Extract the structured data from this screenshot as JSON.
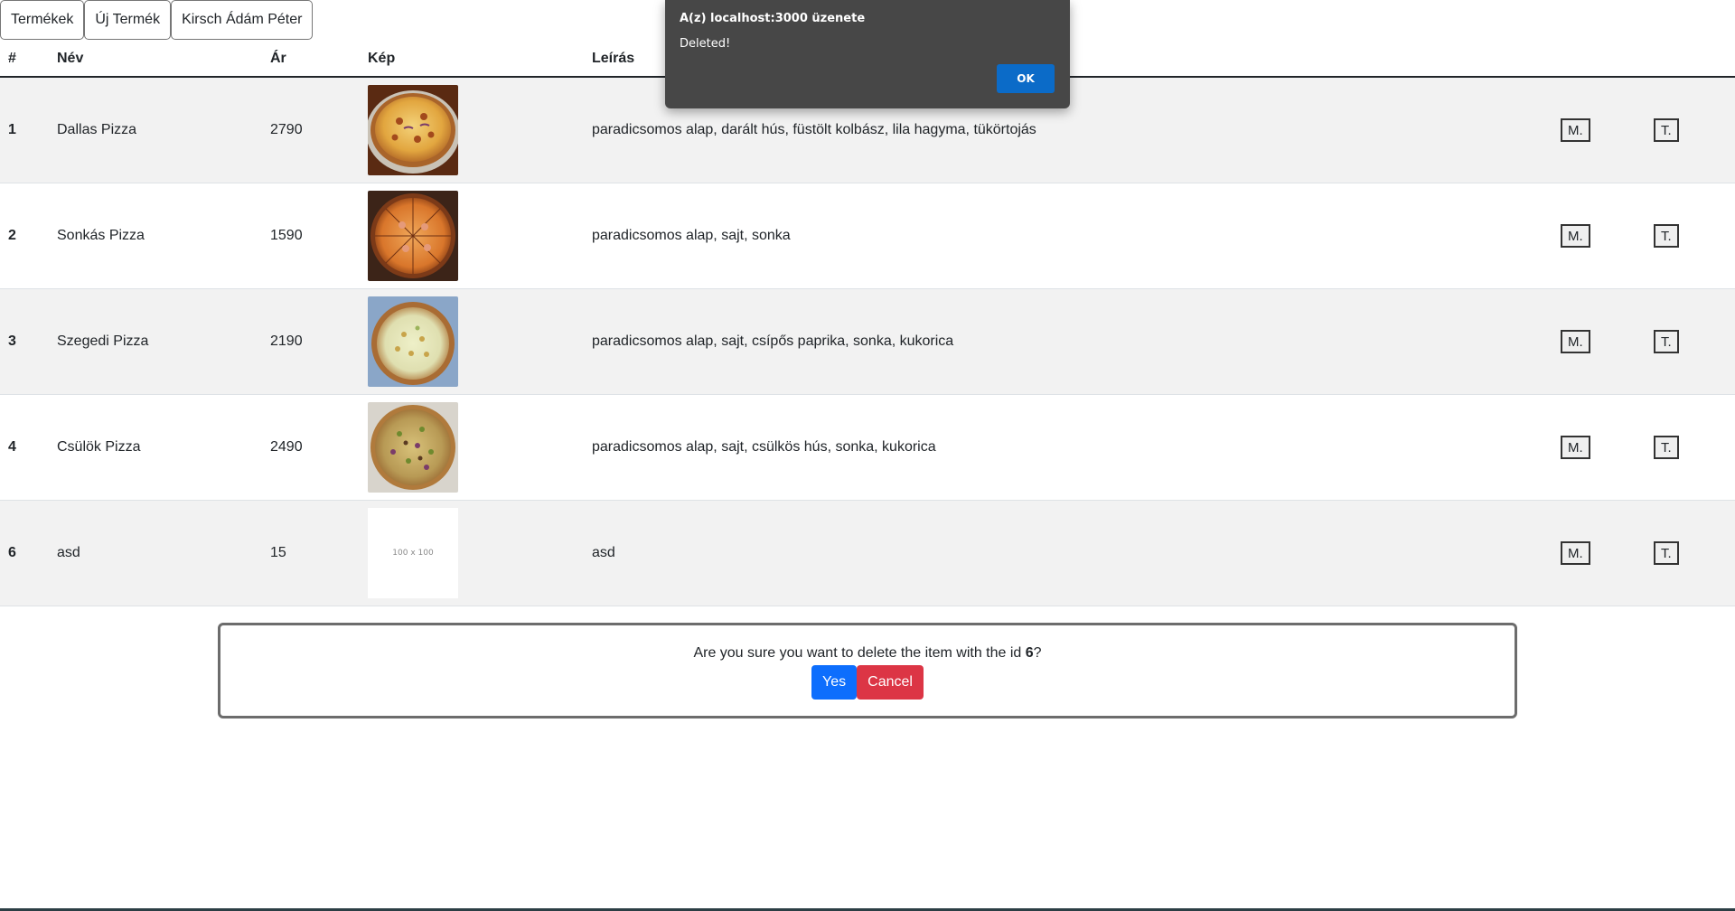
{
  "nav": {
    "products": "Termékek",
    "new_product": "Új Termék",
    "user": "Kirsch Ádám Péter"
  },
  "table": {
    "headers": [
      "#",
      "Név",
      "Ár",
      "Kép",
      "Leírás"
    ],
    "rows": [
      {
        "id": "1",
        "name": "Dallas Pizza",
        "price": "2790",
        "desc": "paradicsomos alap, darált hús, füstölt kolbász, lila hagyma, tükörtojás",
        "image": "pizza-dallas",
        "edit": "M.",
        "delete": "T."
      },
      {
        "id": "2",
        "name": "Sonkás Pizza",
        "price": "1590",
        "desc": "paradicsomos alap, sajt, sonka",
        "image": "pizza-ham",
        "edit": "M.",
        "delete": "T."
      },
      {
        "id": "3",
        "name": "Szegedi Pizza",
        "price": "2190",
        "desc": "paradicsomos alap, sajt, csípős paprika, sonka, kukorica",
        "image": "pizza-szeged",
        "edit": "M.",
        "delete": "T."
      },
      {
        "id": "4",
        "name": "Csülök Pizza",
        "price": "2490",
        "desc": "paradicsomos alap, sajt, csülkös hús, sonka, kukorica",
        "image": "pizza-knuckle",
        "edit": "M.",
        "delete": "T."
      },
      {
        "id": "6",
        "name": "asd",
        "price": "15",
        "desc": "asd",
        "image": "placeholder",
        "placeholder_text": "100 x 100",
        "edit": "M.",
        "delete": "T."
      }
    ]
  },
  "confirm": {
    "text_before": "Are you sure you want to delete the item with the id ",
    "id": "6",
    "text_after": "?",
    "yes": "Yes",
    "cancel": "Cancel"
  },
  "alert": {
    "title": "A(z) localhost:3000 üzenete",
    "message": "Deleted!",
    "ok": "OK"
  },
  "colors": {
    "primary": "#0d6efd",
    "danger": "#dc3545",
    "alert_bg": "#474747",
    "alert_ok": "#0b6bc8",
    "stripe": "#f2f2f2"
  }
}
